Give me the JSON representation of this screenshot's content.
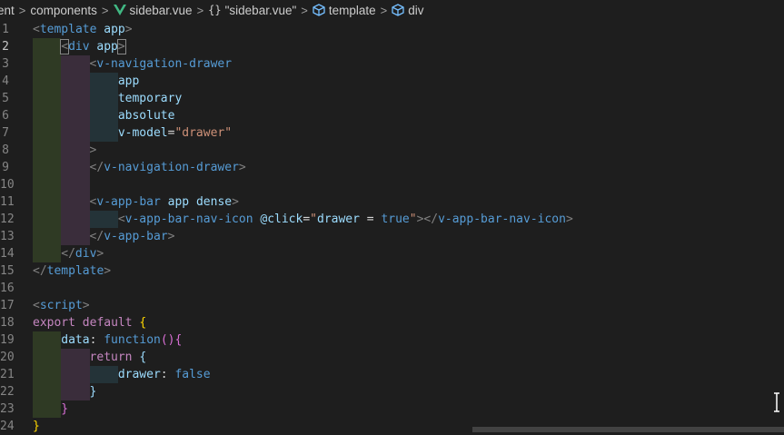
{
  "breadcrumb": {
    "items": [
      {
        "label": "ent",
        "icon": "none"
      },
      {
        "label": "components",
        "icon": "none"
      },
      {
        "label": "sidebar.vue",
        "icon": "vue-icon"
      },
      {
        "label": "\"sidebar.vue\"",
        "icon": "braces-icon"
      },
      {
        "label": "template",
        "icon": "cube-icon"
      },
      {
        "label": "div",
        "icon": "cube-icon"
      }
    ],
    "separator": ">"
  },
  "editor": {
    "active_line": 2,
    "lines": [
      {
        "number": "1",
        "tokens": [
          [
            "t-punc",
            "<"
          ],
          [
            "t-tag",
            "template"
          ],
          [
            "",
            ""
          ],
          [
            "t-attr",
            " app"
          ],
          [
            "t-punc",
            ">"
          ]
        ]
      },
      {
        "number": "2",
        "tokens": [
          [
            "t-punc",
            "<"
          ],
          [
            "t-tag",
            "div"
          ],
          [
            "t-attr",
            " app"
          ],
          [
            "t-punc",
            ">"
          ]
        ]
      },
      {
        "number": "3",
        "tokens": [
          [
            "t-punc",
            "<"
          ],
          [
            "t-tag",
            "v-navigation-drawer"
          ]
        ]
      },
      {
        "number": "4",
        "tokens": [
          [
            "t-attr",
            "app"
          ]
        ]
      },
      {
        "number": "5",
        "tokens": [
          [
            "t-attr",
            "temporary"
          ]
        ]
      },
      {
        "number": "6",
        "tokens": [
          [
            "t-attr",
            "absolute"
          ]
        ]
      },
      {
        "number": "7",
        "tokens": [
          [
            "t-attr",
            "v-model"
          ],
          [
            "",
            "="
          ],
          [
            "t-str",
            "\"drawer\""
          ]
        ]
      },
      {
        "number": "8",
        "tokens": [
          [
            "t-punc",
            ">"
          ]
        ]
      },
      {
        "number": "9",
        "tokens": [
          [
            "t-punc",
            "</"
          ],
          [
            "t-tag",
            "v-navigation-drawer"
          ],
          [
            "t-punc",
            ">"
          ]
        ]
      },
      {
        "number": "10",
        "tokens": []
      },
      {
        "number": "11",
        "tokens": [
          [
            "t-punc",
            "<"
          ],
          [
            "t-tag",
            "v-app-bar"
          ],
          [
            "t-attr",
            " app dense"
          ],
          [
            "t-punc",
            ">"
          ]
        ]
      },
      {
        "number": "12",
        "tokens": [
          [
            "t-punc",
            "<"
          ],
          [
            "t-tag",
            "v-app-bar-nav-icon"
          ],
          [
            "t-attr",
            " @click"
          ],
          [
            "",
            "="
          ],
          [
            "t-str",
            "\""
          ],
          [
            "t-attr",
            "drawer"
          ],
          [
            "",
            " = "
          ],
          [
            "t-val",
            "true"
          ],
          [
            "t-str",
            "\""
          ],
          [
            "t-punc",
            "></"
          ],
          [
            "t-tag",
            "v-app-bar-nav-icon"
          ],
          [
            "t-punc",
            ">"
          ]
        ]
      },
      {
        "number": "13",
        "tokens": [
          [
            "t-punc",
            "</"
          ],
          [
            "t-tag",
            "v-app-bar"
          ],
          [
            "t-punc",
            ">"
          ]
        ]
      },
      {
        "number": "14",
        "tokens": [
          [
            "t-punc",
            "</"
          ],
          [
            "t-tag",
            "div"
          ],
          [
            "t-punc",
            ">"
          ]
        ]
      },
      {
        "number": "15",
        "tokens": [
          [
            "t-punc",
            "</"
          ],
          [
            "t-tag",
            "template"
          ],
          [
            "t-punc",
            ">"
          ]
        ]
      },
      {
        "number": "16",
        "tokens": []
      },
      {
        "number": "17",
        "tokens": [
          [
            "t-punc",
            "<"
          ],
          [
            "t-tag",
            "script"
          ],
          [
            "t-punc",
            ">"
          ]
        ]
      },
      {
        "number": "18",
        "tokens": [
          [
            "t-kw",
            "export"
          ],
          [
            "",
            " "
          ],
          [
            "t-kw",
            "default"
          ],
          [
            "",
            " "
          ],
          [
            "t-br1",
            "{"
          ]
        ]
      },
      {
        "number": "19",
        "tokens": [
          [
            "t-attr",
            "data"
          ],
          [
            "",
            ": "
          ],
          [
            "t-val",
            "function"
          ],
          [
            "t-br2",
            "(){"
          ]
        ]
      },
      {
        "number": "20",
        "tokens": [
          [
            "t-kw",
            "return"
          ],
          [
            "",
            " "
          ],
          [
            "t-attr",
            "{"
          ]
        ]
      },
      {
        "number": "21",
        "tokens": [
          [
            "t-attr",
            "drawer"
          ],
          [
            "",
            ": "
          ],
          [
            "t-val",
            "false"
          ]
        ]
      },
      {
        "number": "22",
        "tokens": [
          [
            "t-attr",
            "}"
          ]
        ]
      },
      {
        "number": "23",
        "tokens": [
          [
            "t-br2",
            "}"
          ]
        ]
      },
      {
        "number": "24",
        "tokens": [
          [
            "t-br1",
            "}"
          ]
        ]
      }
    ]
  }
}
